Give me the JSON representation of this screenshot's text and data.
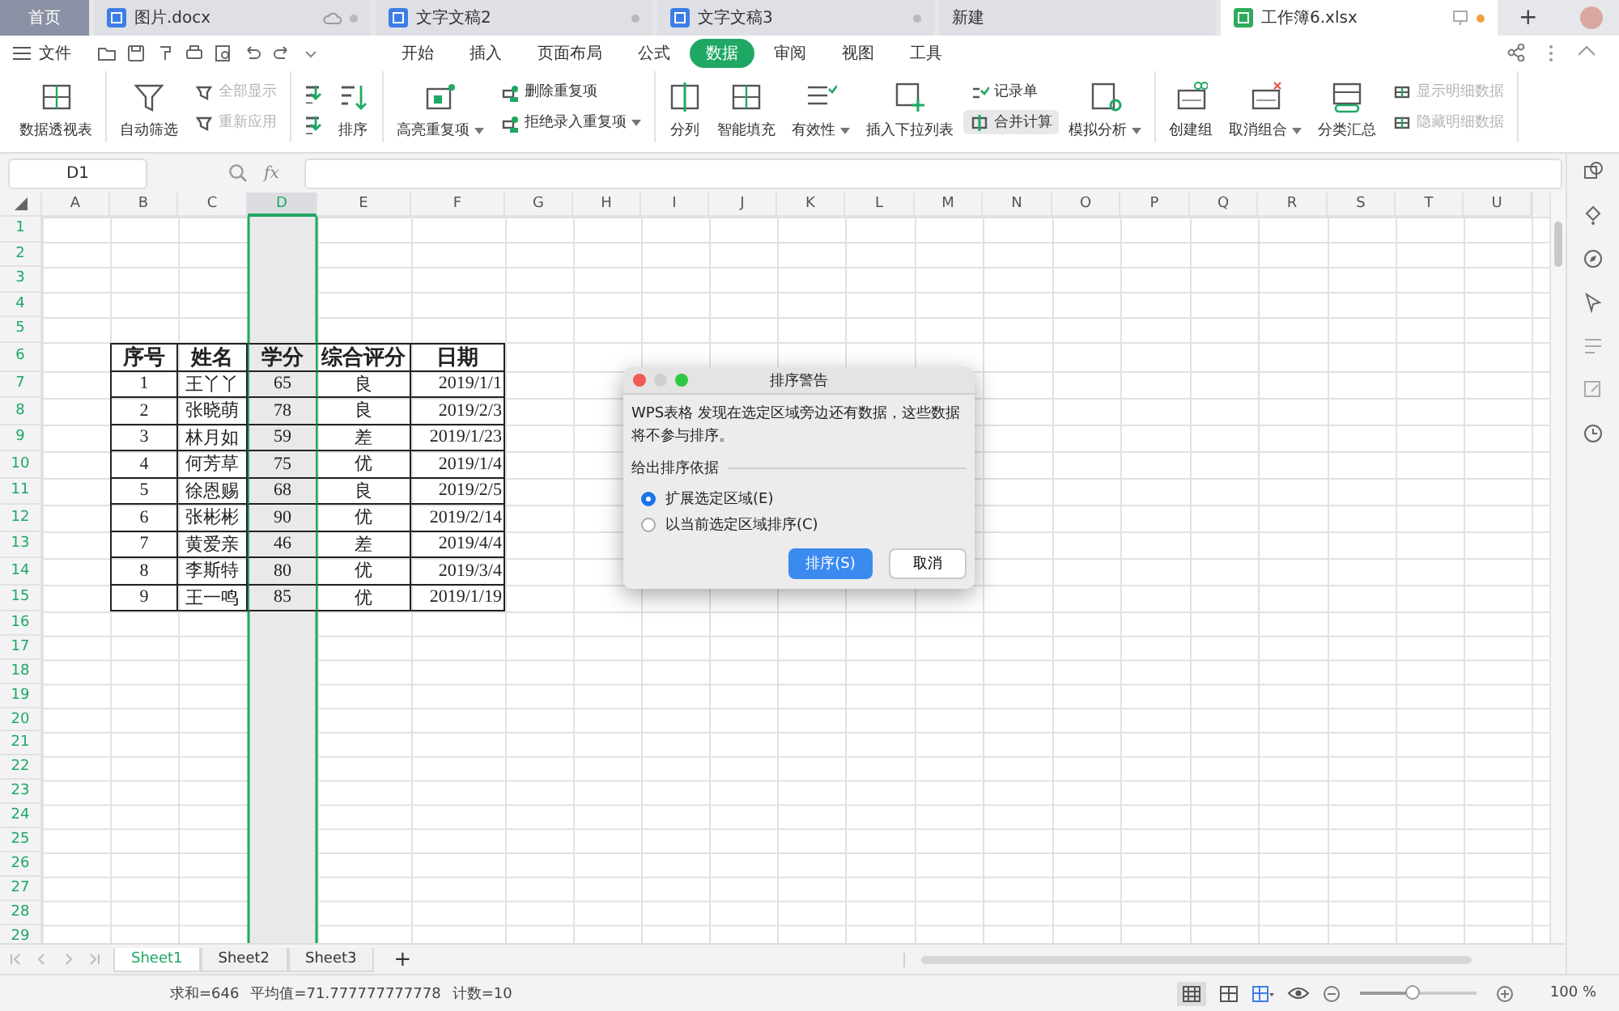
{
  "doc_tabs": [
    {
      "kind": "home",
      "label": "首页",
      "selected": false
    },
    {
      "kind": "writer",
      "label": "图片.docx",
      "selected": false,
      "unsaved": false
    },
    {
      "kind": "writer",
      "label": "文字文稿2",
      "selected": false,
      "unsaved": false
    },
    {
      "kind": "writer",
      "label": "文字文稿3",
      "selected": false,
      "unsaved": false
    },
    {
      "kind": "new",
      "label": "新建",
      "selected": false
    },
    {
      "kind": "sheet",
      "label": "工作簿6.xlsx",
      "selected": true,
      "unsaved": true
    }
  ],
  "new_tab": "+",
  "menu": {
    "file": "文件",
    "tabs": [
      {
        "label": "开始",
        "selected": false
      },
      {
        "label": "插入",
        "selected": false
      },
      {
        "label": "页面布局",
        "selected": false
      },
      {
        "label": "公式",
        "selected": false
      },
      {
        "label": "数据",
        "selected": true
      },
      {
        "label": "审阅",
        "selected": false
      },
      {
        "label": "视图",
        "selected": false
      },
      {
        "label": "工具",
        "selected": false
      }
    ]
  },
  "ribbon": {
    "groups": [
      {
        "items": [
          {
            "kind": "large",
            "label": "数据透视表",
            "disabled": false,
            "dropdown": false,
            "hovered": false
          }
        ]
      },
      {
        "items": [
          {
            "kind": "large",
            "label": "自动筛选",
            "disabled": false,
            "dropdown": false,
            "hovered": false
          },
          {
            "kind": "stack",
            "items": [
              {
                "label": "全部显示",
                "disabled": true,
                "dropdown": false,
                "hovered": false
              },
              {
                "label": "重新应用",
                "disabled": true,
                "dropdown": false,
                "hovered": false
              }
            ]
          }
        ]
      },
      {
        "items": [
          {
            "kind": "sort-pair"
          },
          {
            "kind": "large",
            "label": "排序",
            "disabled": false,
            "dropdown": false,
            "hovered": false
          }
        ]
      },
      {
        "items": [
          {
            "kind": "large",
            "label": "高亮重复项",
            "disabled": false,
            "dropdown": true,
            "hovered": false
          },
          {
            "kind": "stack",
            "items": [
              {
                "label": "删除重复项",
                "disabled": false,
                "dropdown": false,
                "hovered": false
              },
              {
                "label": "拒绝录入重复项",
                "disabled": false,
                "dropdown": true,
                "hovered": false
              }
            ]
          }
        ]
      },
      {
        "items": [
          {
            "kind": "large",
            "label": "分列",
            "disabled": false,
            "dropdown": false,
            "hovered": false
          },
          {
            "kind": "large",
            "label": "智能填充",
            "disabled": false,
            "dropdown": false,
            "hovered": false
          },
          {
            "kind": "large",
            "label": "有效性",
            "disabled": false,
            "dropdown": true,
            "hovered": false
          },
          {
            "kind": "large",
            "label": "插入下拉列表",
            "disabled": false,
            "dropdown": false,
            "hovered": false
          },
          {
            "kind": "stack",
            "items": [
              {
                "label": "记录单",
                "disabled": false,
                "dropdown": false,
                "hovered": false
              },
              {
                "label": "合并计算",
                "disabled": false,
                "dropdown": false,
                "hovered": true
              }
            ]
          },
          {
            "kind": "large",
            "label": "模拟分析",
            "disabled": false,
            "dropdown": true,
            "hovered": false
          }
        ]
      },
      {
        "items": [
          {
            "kind": "large",
            "label": "创建组",
            "disabled": false,
            "dropdown": false,
            "hovered": false
          },
          {
            "kind": "large",
            "label": "取消组合",
            "disabled": false,
            "dropdown": true,
            "hovered": false
          },
          {
            "kind": "large",
            "label": "分类汇总",
            "disabled": false,
            "dropdown": false,
            "hovered": false
          },
          {
            "kind": "stack",
            "items": [
              {
                "label": "显示明细数据",
                "disabled": true,
                "dropdown": false,
                "hovered": false
              },
              {
                "label": "隐藏明细数据",
                "disabled": true,
                "dropdown": false,
                "hovered": false
              }
            ]
          }
        ]
      }
    ]
  },
  "formula_bar": {
    "name_box": "D1",
    "function_label": "fx"
  },
  "grid": {
    "columns": [
      {
        "label": "A",
        "selected": false
      },
      {
        "label": "B",
        "selected": false
      },
      {
        "label": "C",
        "selected": false
      },
      {
        "label": "D",
        "selected": true
      },
      {
        "label": "E",
        "selected": false
      },
      {
        "label": "F",
        "selected": false
      },
      {
        "label": "G",
        "selected": false
      },
      {
        "label": "H",
        "selected": false
      },
      {
        "label": "I",
        "selected": false
      },
      {
        "label": "J",
        "selected": false
      },
      {
        "label": "K",
        "selected": false
      },
      {
        "label": "L",
        "selected": false
      },
      {
        "label": "M",
        "selected": false
      },
      {
        "label": "N",
        "selected": false
      },
      {
        "label": "O",
        "selected": false
      },
      {
        "label": "P",
        "selected": false
      },
      {
        "label": "Q",
        "selected": false
      },
      {
        "label": "R",
        "selected": false
      },
      {
        "label": "S",
        "selected": false
      },
      {
        "label": "T",
        "selected": false
      },
      {
        "label": "U",
        "selected": false
      }
    ],
    "rows": [
      "1",
      "2",
      "3",
      "4",
      "5",
      "6",
      "7",
      "8",
      "9",
      "10",
      "11",
      "12",
      "13",
      "14",
      "15",
      "16",
      "17",
      "18",
      "19",
      "20",
      "21",
      "22",
      "23",
      "24",
      "25",
      "26",
      "27",
      "28",
      "29"
    ],
    "table": {
      "header": [
        "序号",
        "姓名",
        "学分",
        "综合评分",
        "日期"
      ],
      "rows": [
        [
          "1",
          "王丫丫",
          "65",
          "良",
          "2019/1/1"
        ],
        [
          "2",
          "张晓萌",
          "78",
          "良",
          "2019/2/3"
        ],
        [
          "3",
          "林月如",
          "59",
          "差",
          "2019/1/23"
        ],
        [
          "4",
          "何芳草",
          "75",
          "优",
          "2019/1/4"
        ],
        [
          "5",
          "徐恩赐",
          "68",
          "良",
          "2019/2/5"
        ],
        [
          "6",
          "张彬彬",
          "90",
          "优",
          "2019/2/14"
        ],
        [
          "7",
          "黄爱亲",
          "46",
          "差",
          "2019/4/4"
        ],
        [
          "8",
          "李斯特",
          "80",
          "优",
          "2019/3/4"
        ],
        [
          "9",
          "王一鸣",
          "85",
          "优",
          "2019/1/19"
        ]
      ]
    }
  },
  "sheets": {
    "tabs": [
      {
        "label": "Sheet1",
        "selected": true
      },
      {
        "label": "Sheet2",
        "selected": false
      },
      {
        "label": "Sheet3",
        "selected": false
      }
    ],
    "add": "+"
  },
  "status_bar": {
    "summary": [
      "求和=646",
      "平均值=71.777777777778",
      "计数=10"
    ],
    "zoom": {
      "level": 0.45,
      "reading": "100 %"
    }
  },
  "dialog": {
    "title": "排序警告",
    "message": "WPS表格 发现在选定区域旁边还有数据，这些数据将不参与排序。",
    "group_label": "给出排序依据",
    "options": [
      {
        "label": "扩展选定区域(E)",
        "selected": true
      },
      {
        "label": "以当前选定区域排序(C)",
        "selected": false
      }
    ],
    "buttons": [
      {
        "label": "排序(S)",
        "kind": "primary"
      },
      {
        "label": "取消",
        "kind": "secondary"
      }
    ]
  }
}
